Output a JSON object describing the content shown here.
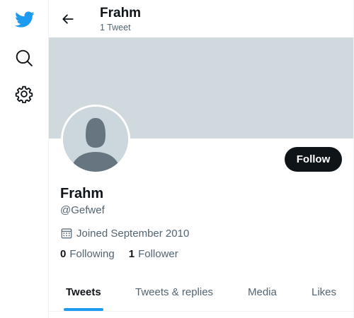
{
  "colors": {
    "accent": "#1d9bf0",
    "banner": "#cfd9de",
    "text_primary": "#0f1419",
    "text_secondary": "#536471",
    "follow_button_bg": "#0f1419"
  },
  "nav": {
    "items": [
      {
        "icon": "twitter-bird-icon"
      },
      {
        "icon": "search-icon"
      },
      {
        "icon": "gear-icon"
      }
    ]
  },
  "header": {
    "back_icon": "back-arrow-icon",
    "title": "Frahm",
    "subtitle": "1 Tweet"
  },
  "profile": {
    "display_name": "Frahm",
    "handle": "@Gefwef",
    "joined": "Joined September 2010",
    "joined_icon": "calendar-icon",
    "avatar_icon": "default-avatar-icon",
    "follow_label": "Follow",
    "following_count": "0",
    "following_label": "Following",
    "followers_count": "1",
    "followers_label": "Follower"
  },
  "tabs": [
    {
      "label": "Tweets",
      "active": true
    },
    {
      "label": "Tweets & replies",
      "active": false
    },
    {
      "label": "Media",
      "active": false
    },
    {
      "label": "Likes",
      "active": false
    }
  ]
}
